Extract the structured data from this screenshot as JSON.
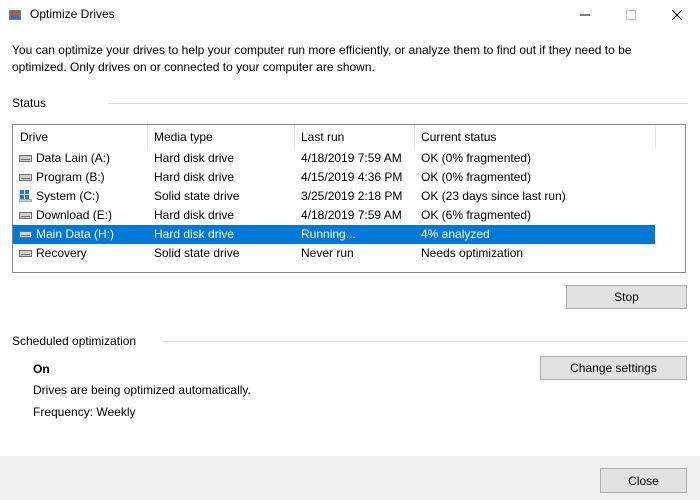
{
  "window": {
    "title": "Optimize Drives",
    "minimize_icon": "minimize-icon",
    "maximize_icon": "maximize-icon",
    "close_icon": "close-icon"
  },
  "description": "You can optimize your drives to help your computer run more efficiently, or analyze them to find out if they need to be optimized. Only drives on or connected to your computer are shown.",
  "status": {
    "label": "Status",
    "columns": {
      "drive": "Drive",
      "media_type": "Media type",
      "last_run": "Last run",
      "current_status": "Current status"
    },
    "drives": [
      {
        "icon": "hard-disk-icon",
        "drive": "Data Lain (A:)",
        "media_type": "Hard disk drive",
        "last_run": "4/18/2019 7:59 AM",
        "current_status": "OK (0% fragmented)"
      },
      {
        "icon": "hard-disk-icon",
        "drive": "Program (B:)",
        "media_type": "Hard disk drive",
        "last_run": "4/15/2019 4:36 PM",
        "current_status": "OK (0% fragmented)"
      },
      {
        "icon": "windows-drive-icon",
        "drive": "System (C:)",
        "media_type": "Solid state drive",
        "last_run": "3/25/2019 2:18 PM",
        "current_status": "OK (23 days since last run)"
      },
      {
        "icon": "hard-disk-icon",
        "drive": "Download (E:)",
        "media_type": "Hard disk drive",
        "last_run": "4/18/2019 7:59 AM",
        "current_status": "OK (6% fragmented)"
      },
      {
        "icon": "hard-disk-icon",
        "drive": "Main Data (H:)",
        "media_type": "Hard disk drive",
        "last_run": "Running...",
        "current_status": "4% analyzed",
        "selected": true
      },
      {
        "icon": "hard-disk-icon",
        "drive": "Recovery",
        "media_type": "Solid state drive",
        "last_run": "Never run",
        "current_status": "Needs optimization"
      }
    ],
    "stop_button": "Stop"
  },
  "scheduled": {
    "label": "Scheduled optimization",
    "state": "On",
    "detail": "Drives are being optimized automatically.",
    "frequency": "Frequency: Weekly",
    "change_settings_button": "Change settings"
  },
  "footer": {
    "close_button": "Close"
  },
  "colors": {
    "selection": "#0078d7",
    "button_face": "#e1e1e1",
    "footer_bg": "#f0f0f0"
  }
}
